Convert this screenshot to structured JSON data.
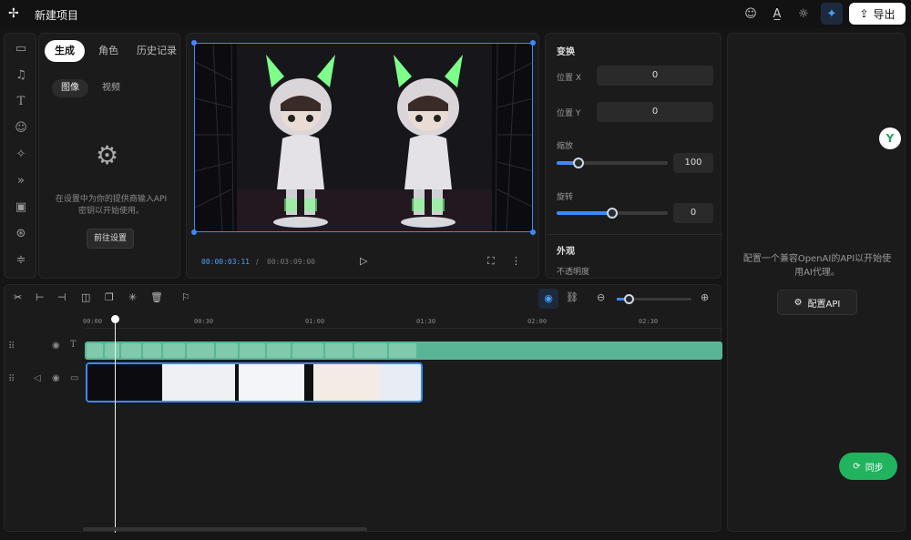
{
  "app": {
    "title": "新建项目",
    "export_label": "导出"
  },
  "sidebar_tabs": [
    "生成",
    "角色",
    "历史记录"
  ],
  "gen": {
    "subtabs": [
      "图像",
      "视频"
    ],
    "note": "在设置中为你的提供商输入API密钥以开始使用。",
    "button": "前往设置"
  },
  "preview": {
    "current_time": "00:00:03:11",
    "separator": "/",
    "total_time": "00:03:09:00"
  },
  "props": {
    "transform_title": "变换",
    "pos_x_label": "位置 X",
    "pos_x": "0",
    "pos_y_label": "位置 Y",
    "pos_y": "0",
    "scale_label": "缩放",
    "scale": "100",
    "rotate_label": "旋转",
    "rotate": "0",
    "appearance_title": "外观",
    "opacity_label": "不透明度"
  },
  "ai": {
    "badge": "Y",
    "note": "配置一个兼容OpenAI的API以开始使用AI代理。",
    "config_button": "配置API",
    "sync_button": "同步"
  },
  "timeline": {
    "ticks": [
      "00:00",
      "00:30",
      "01:00",
      "01:30",
      "02:00",
      "02:30"
    ]
  },
  "colors": {
    "accent": "#3b8bff",
    "sync": "#21b35e",
    "subtitle": "#5ab596"
  }
}
